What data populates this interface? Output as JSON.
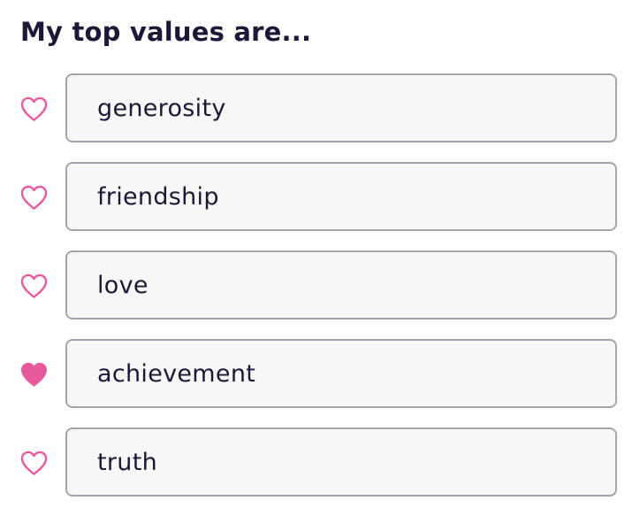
{
  "title": "My top values are...",
  "colors": {
    "heart": "#e8589c",
    "text": "#1b1838",
    "field_border": "#a3a4b0",
    "field_bg": "#f7f7f8"
  },
  "values": [
    {
      "label": "generosity",
      "favorited": false,
      "icon": "heart-outline-icon"
    },
    {
      "label": "friendship",
      "favorited": false,
      "icon": "heart-outline-icon"
    },
    {
      "label": "love",
      "favorited": false,
      "icon": "heart-outline-icon"
    },
    {
      "label": "achievement",
      "favorited": true,
      "icon": "heart-filled-icon"
    },
    {
      "label": "truth",
      "favorited": false,
      "icon": "heart-outline-icon"
    }
  ]
}
